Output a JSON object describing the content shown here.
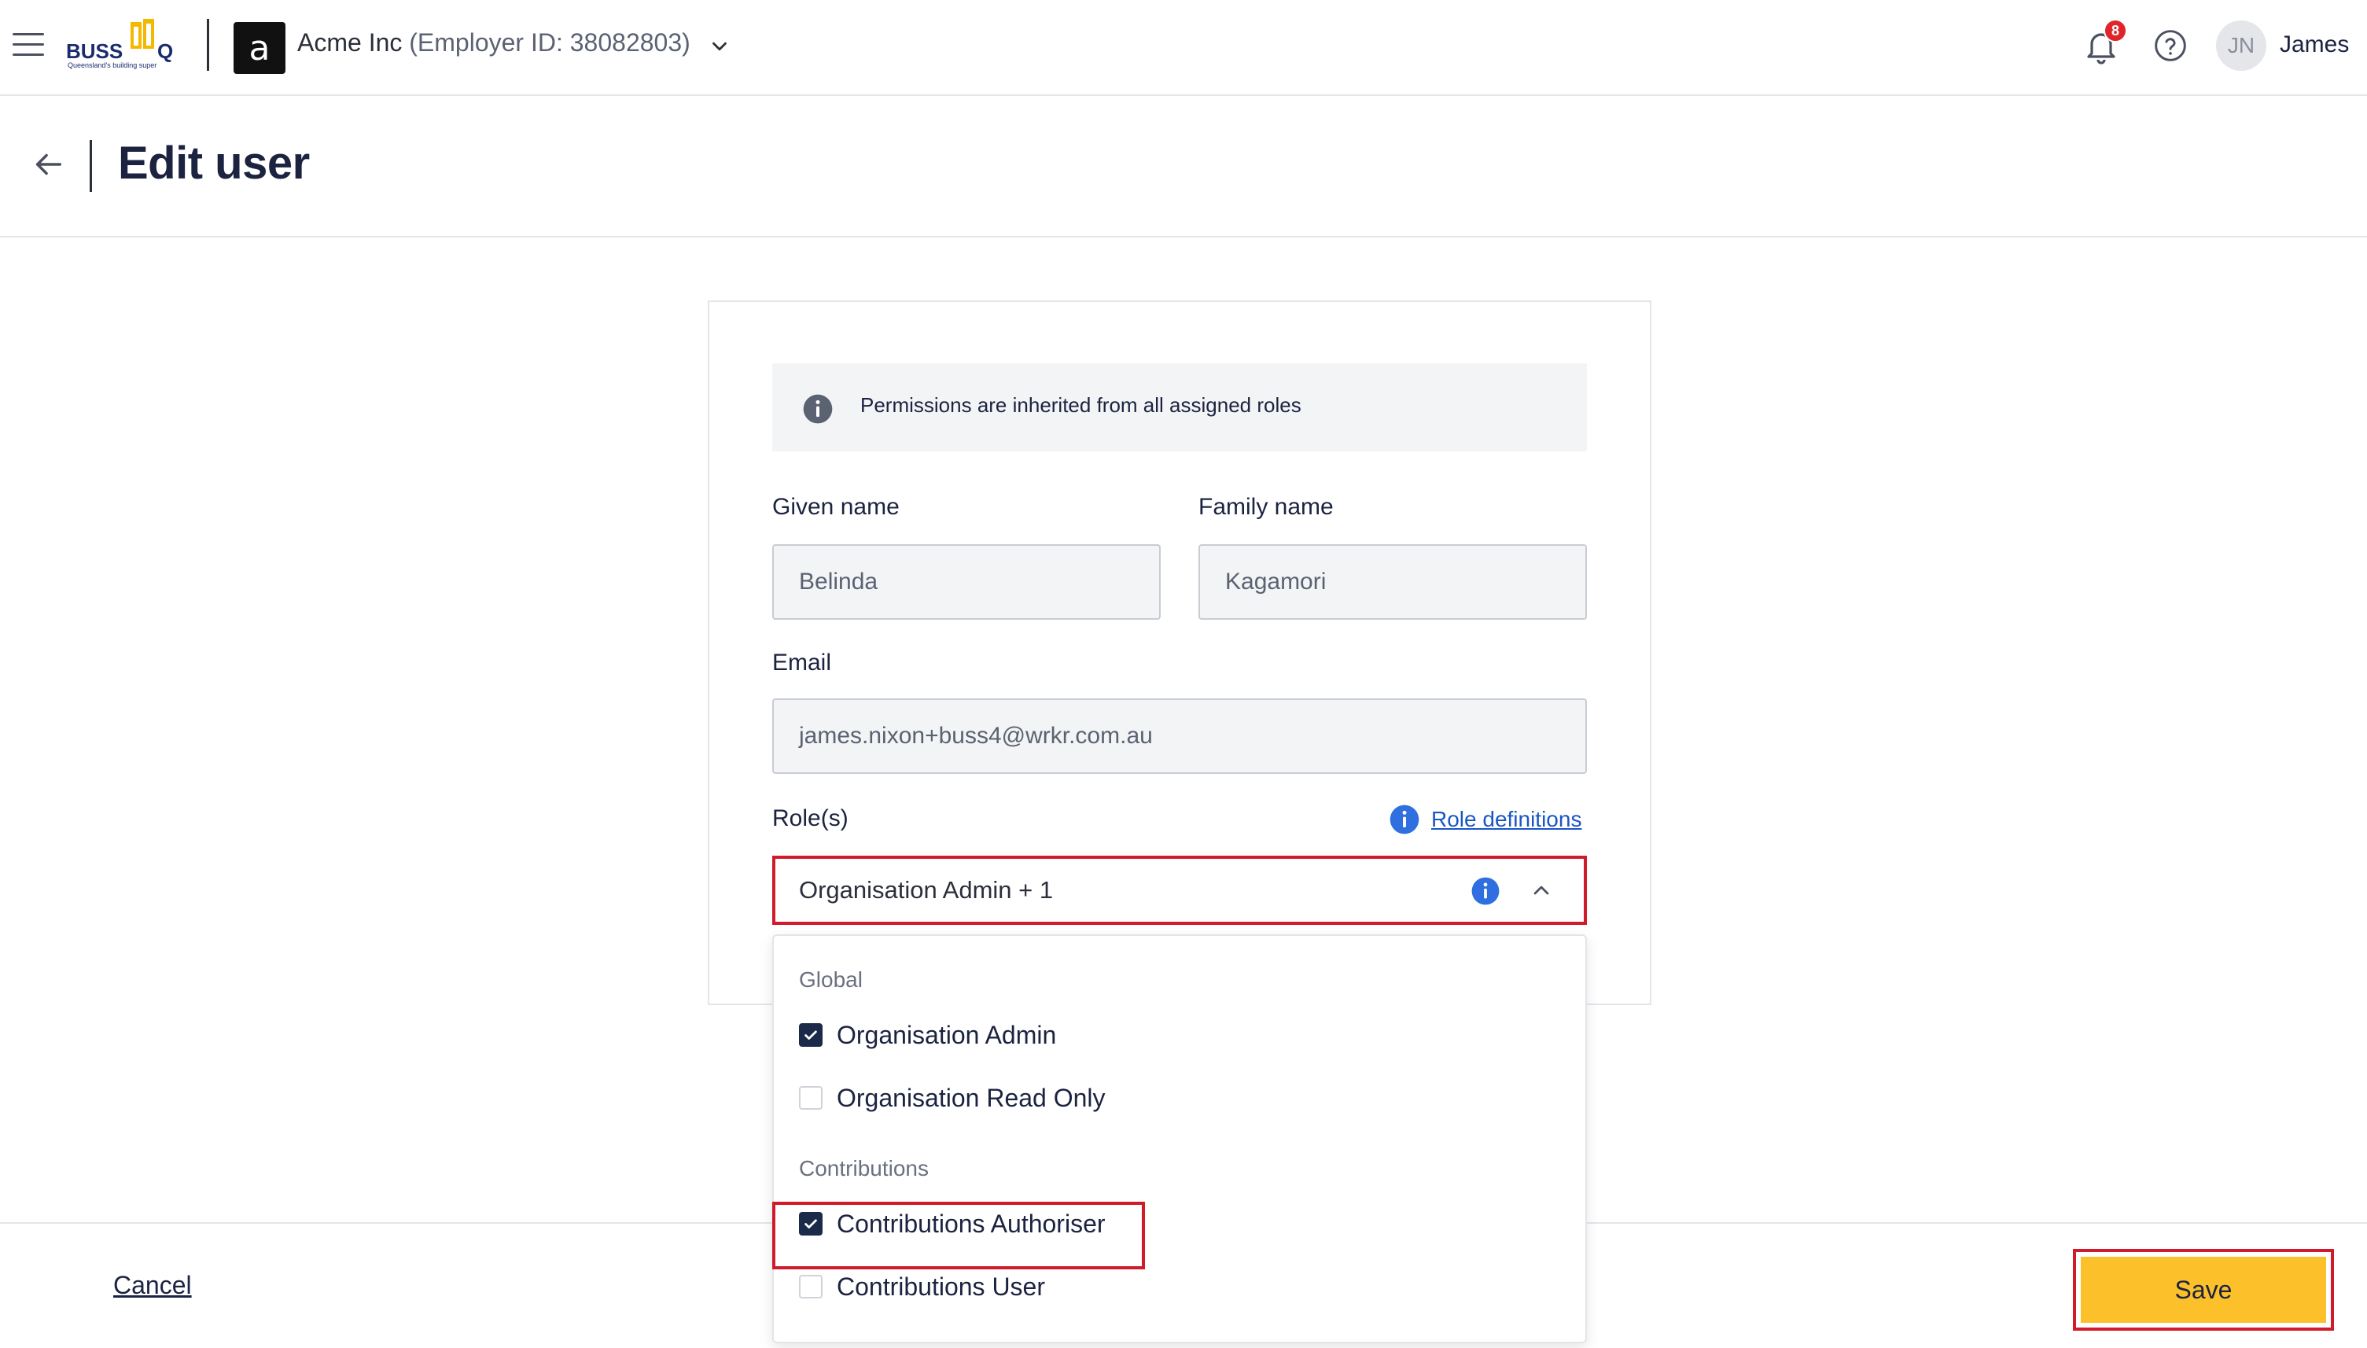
{
  "app": {
    "logo_text": "BUSSQ",
    "logo_tagline": "Queensland's building super",
    "org_initial": "a",
    "org_name": "Acme Inc",
    "org_id": "(Employer ID: 38082803)",
    "notifications_count": "8",
    "user_initials": "JN",
    "user_name": "James"
  },
  "page": {
    "title": "Edit user"
  },
  "form": {
    "info_banner": "Permissions are inherited from all assigned roles",
    "given_name_label": "Given name",
    "given_name_value": "Belinda",
    "family_name_label": "Family name",
    "family_name_value": "Kagamori",
    "email_label": "Email",
    "email_value": "james.nixon+buss4@wrkr.com.au",
    "roles_label": "Role(s)",
    "role_definitions_link": "Role definitions",
    "roles_selected": "Organisation Admin + 1"
  },
  "dropdown": {
    "groups": [
      {
        "label": "Global",
        "options": [
          {
            "label": "Organisation Admin",
            "checked": true
          },
          {
            "label": "Organisation Read Only",
            "checked": false
          }
        ]
      },
      {
        "label": "Contributions",
        "options": [
          {
            "label": "Contributions Authoriser",
            "checked": true
          },
          {
            "label": "Contributions User",
            "checked": false
          }
        ]
      }
    ]
  },
  "footer": {
    "cancel_label": "Cancel",
    "save_label": "Save"
  },
  "colors": {
    "accent_yellow": "#fcc02a",
    "highlight_red": "#d11b2b",
    "checkbox_navy": "#1c2a4a",
    "link_blue": "#1a56c4",
    "badge_red": "#e0242b"
  }
}
